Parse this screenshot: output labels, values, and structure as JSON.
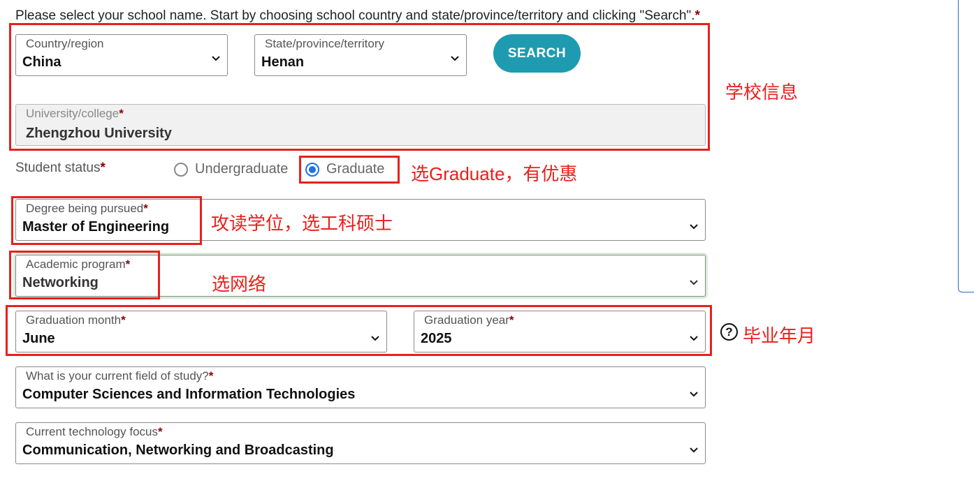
{
  "instruction": "Please select your school name. Start by choosing school country and state/province/territory and clicking \"Search\".",
  "required_mark": "*",
  "school": {
    "country": {
      "label": "Country/region",
      "value": "China"
    },
    "state": {
      "label": "State/province/territory",
      "value": "Henan"
    },
    "search_label": "SEARCH",
    "university": {
      "label": "University/college",
      "value": "Zhengzhou University"
    }
  },
  "status": {
    "label": "Student status",
    "options": [
      {
        "label": "Undergraduate",
        "selected": false
      },
      {
        "label": "Graduate",
        "selected": true
      }
    ]
  },
  "degree": {
    "label": "Degree being pursued",
    "value": "Master of Engineering"
  },
  "program": {
    "label": "Academic program",
    "value": "Networking"
  },
  "grad_month": {
    "label": "Graduation month",
    "value": "June"
  },
  "grad_year": {
    "label": "Graduation year",
    "value": "2025"
  },
  "field_of_study": {
    "label": "What is your current field of study?",
    "value": "Computer Sciences and Information Technologies"
  },
  "tech_focus": {
    "label": "Current technology focus",
    "value": "Communication, Networking and Broadcasting"
  },
  "help_icon_glyph": "?",
  "annotations": {
    "school_info": "学校信息",
    "graduate": "选Graduate，有优惠",
    "degree": "攻读学位，选工科硕士",
    "program": "选网络",
    "graduation": "毕业年月"
  },
  "colors": {
    "accent": "#1e9bb0",
    "annotation_red": "#e8201c",
    "radio_selected": "#1a73e8",
    "required": "#8b0000"
  }
}
